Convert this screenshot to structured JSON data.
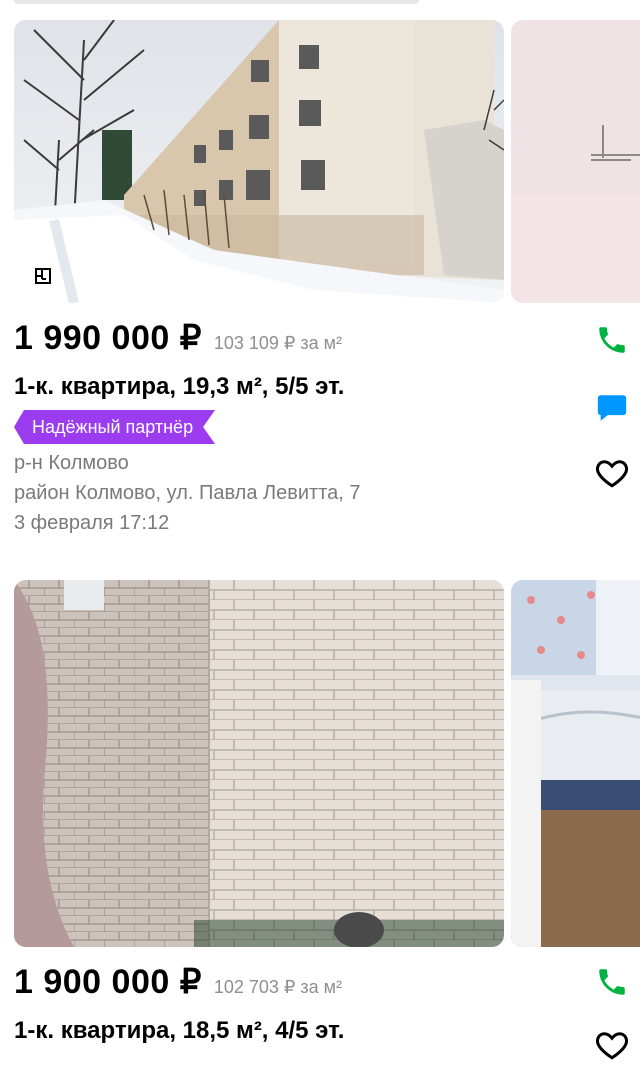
{
  "listings": [
    {
      "price": "1 990 000 ₽",
      "price_per_m2": "103 109 ₽ за м²",
      "title": "1-к. квартира, 19,3 м², 5/5 эт.",
      "badge": "Надёжный партнёр",
      "district": "р-н Колмово",
      "address": "район Колмово, ул. Павла Левитта, 7",
      "date": "3 февраля 17:12",
      "actions": {
        "call_icon": "phone-icon",
        "message_icon": "chat-icon",
        "favorite_icon": "heart-icon"
      },
      "photo_icons": {
        "plan_icon": "floor-plan-icon"
      }
    },
    {
      "price": "1 900 000 ₽",
      "price_per_m2": "102 703 ₽ за м²",
      "title": "1-к. квартира, 18,5 м², 4/5 эт.",
      "actions": {
        "call_icon": "phone-icon",
        "favorite_icon": "heart-icon"
      }
    }
  ],
  "colors": {
    "accent_green": "#00b341",
    "accent_blue": "#0096ff",
    "badge_purple": "#9b3cf0",
    "secondary_text": "#7a7a7a"
  }
}
